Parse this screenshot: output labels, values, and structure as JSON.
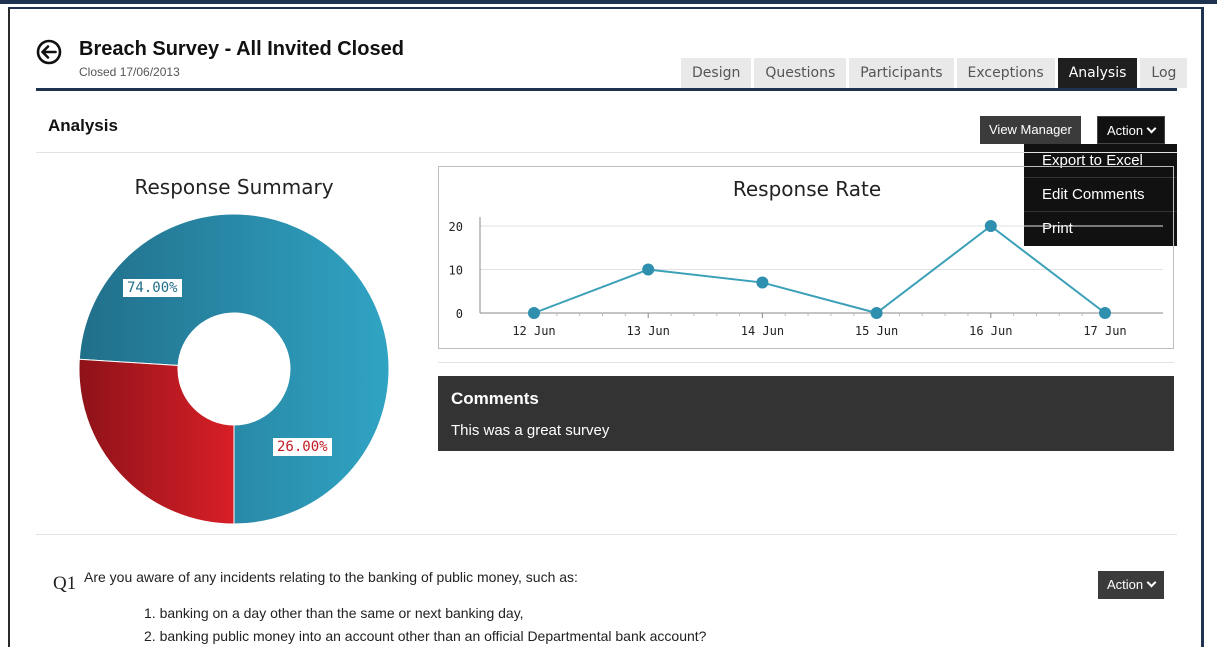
{
  "header": {
    "title": "Breach Survey - All Invited Closed",
    "subtitle": "Closed 17/06/2013"
  },
  "tabs": [
    {
      "label": "Design",
      "active": false
    },
    {
      "label": "Questions",
      "active": false
    },
    {
      "label": "Participants",
      "active": false
    },
    {
      "label": "Exceptions",
      "active": false
    },
    {
      "label": "Analysis",
      "active": true
    },
    {
      "label": "Log",
      "active": false
    }
  ],
  "analysis": {
    "title": "Analysis",
    "view_manager_label": "View Manager",
    "action_label": "Action",
    "action_menu": [
      "Export to Excel",
      "Edit Comments",
      "Print"
    ]
  },
  "colors": {
    "accent_dark": "#1f3350",
    "teal": "#2e9bbd",
    "red": "#c21b24",
    "line": "#3aa0b8"
  },
  "chart_data": [
    {
      "type": "pie",
      "title": "Response Summary",
      "donut": true,
      "values": [
        74,
        26
      ],
      "labels": [
        "74.00%",
        "26.00%"
      ],
      "colors": [
        "#2e9bbd",
        "#c21b24"
      ]
    },
    {
      "type": "line",
      "title": "Response Rate",
      "categories": [
        "12 Jun",
        "13 Jun",
        "14 Jun",
        "15 Jun",
        "16 Jun",
        "17 Jun"
      ],
      "values": [
        0,
        10,
        7,
        0,
        20,
        0
      ],
      "yticks": [
        0,
        10,
        20
      ],
      "ylim": [
        0,
        20
      ],
      "grid": true
    }
  ],
  "comments": {
    "title": "Comments",
    "text": "This was a great survey"
  },
  "question": {
    "number": "Q1",
    "text": "Are you aware of any incidents relating to the banking of public money, such as:",
    "items": [
      "1. banking on a day other than the same or next banking day,",
      "2. banking public money into an account other than an official Departmental bank account?"
    ],
    "action_label": "Action"
  }
}
